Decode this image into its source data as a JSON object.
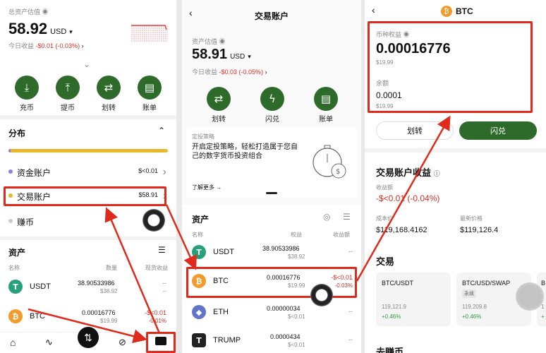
{
  "panel1": {
    "header_label": "总资产估值",
    "total_value": "58.92",
    "currency": "USD",
    "today_label": "今日收益",
    "today_change": "-$0.01 (-0.03%)",
    "actions": [
      {
        "label": "充币",
        "icon": "deposit-icon"
      },
      {
        "label": "提币",
        "icon": "withdraw-icon"
      },
      {
        "label": "划转",
        "icon": "transfer-icon"
      },
      {
        "label": "账单",
        "icon": "bill-icon"
      }
    ],
    "distribution_title": "分布",
    "accounts": [
      {
        "name": "资金账户",
        "value": "$<0.01",
        "color": "#8c7ee8"
      },
      {
        "name": "交易账户",
        "value": "$58.91",
        "color": "#e7b82b"
      },
      {
        "name": "赚币",
        "value": "",
        "color": "#cccccc"
      }
    ],
    "assets_title": "资产",
    "col_name": "名称",
    "col_qty": "数量",
    "col_pnl": "现货收益",
    "assets": [
      {
        "symbol": "USDT",
        "qty": "38.90533986",
        "usd": "$38.92",
        "pnl": "--",
        "pnl2": "--"
      },
      {
        "symbol": "BTC",
        "qty": "0.00016776",
        "usd": "$19.99",
        "pnl": "-$<0.01",
        "pnl2": "-0.01%"
      }
    ]
  },
  "panel2": {
    "title": "交易账户",
    "asset_label": "资产估值",
    "total_value": "58.91",
    "currency": "USD",
    "today_label": "今日收益",
    "today_change": "-$0.03 (-0.05%)",
    "actions": [
      {
        "label": "划转",
        "icon": "transfer-icon"
      },
      {
        "label": "闪兑",
        "icon": "flash-swap-icon"
      },
      {
        "label": "账单",
        "icon": "bill-icon"
      }
    ],
    "promo_title": "定投策略",
    "promo_text": "开启定投策略，轻松打造属于您自己的数字货币投资组合",
    "promo_link": "了解更多 →",
    "assets_title": "资产",
    "col_name": "名称",
    "col_equity": "权益",
    "col_pnl": "收益额",
    "assets": [
      {
        "symbol": "USDT",
        "qty": "38.90533986",
        "usd": "$38.92",
        "pnl": "--",
        "pnl2": ""
      },
      {
        "symbol": "BTC",
        "qty": "0.00016776",
        "usd": "$19.99",
        "pnl": "-$<0.01",
        "pnl2": "-0.03%"
      },
      {
        "symbol": "ETH",
        "qty": "0.00000034",
        "usd": "$<0.01",
        "pnl": "--",
        "pnl2": ""
      },
      {
        "symbol": "TRUMP",
        "qty": "0.0000434",
        "usd": "$<0.01",
        "pnl": "--",
        "pnl2": ""
      }
    ]
  },
  "panel3": {
    "title": "BTC",
    "equity_label": "币种权益",
    "equity_value": "0.00016776",
    "equity_usd": "$19.99",
    "balance_label": "余额",
    "balance_value": "0.0001",
    "balance_usd": "$19.99",
    "transfer_btn": "划转",
    "swap_btn": "闪兑",
    "pnl_section": "交易账户收益",
    "pnl_label": "收益额",
    "pnl_value": "-$<0.01 (-0.04%)",
    "cost_label": "成本价",
    "cost_value": "$119,168.4162",
    "latest_label": "最新价格",
    "latest_value": "$119,126.4",
    "trade_title": "交易",
    "pairs": [
      {
        "name": "BTC/USDT",
        "tag": "",
        "price": "119,121.9",
        "change": "+0.46%"
      },
      {
        "name": "BTC/USD/SWAP",
        "tag": "永续",
        "price": "119,209.8",
        "change": "+0.46%"
      },
      {
        "name": "B",
        "tag": "",
        "price": "1",
        "change": "+"
      }
    ],
    "bottom_title": "去赚币"
  }
}
